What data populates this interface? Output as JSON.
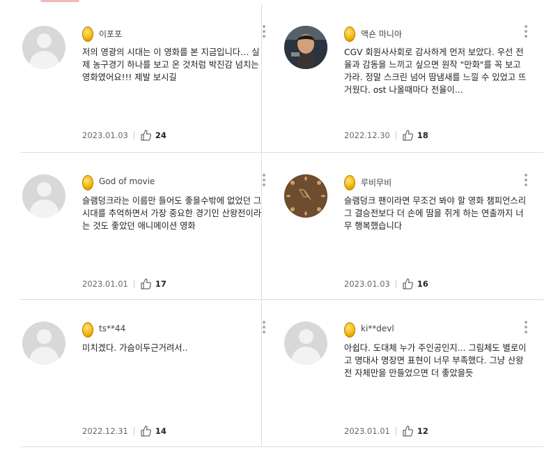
{
  "reviews": [
    {
      "nick": "이포포",
      "text": "저의 영광의 시대는 이 영화를 본 지금입니다… 실제 농구경기 하나를 보고 온 것처럼 박진감 넘치는 영화였어요!!! 제발 보시길",
      "date": "2023.01.03",
      "likes": "24",
      "avatar": "default"
    },
    {
      "nick": "액숀 마니아",
      "text": "CGV 회원사사회로 감사하게 먼저 보았다. 우선 전율과 감동을 느끼고 싶으면 원작 \"만화\"를 꼭 보고 가라. 정말 스크린 넘어 땀냄새를 느낄 수 있었고 뜨거웠다. ost 나올때마다 전율이...",
      "date": "2022.12.30",
      "likes": "18",
      "avatar": "photo"
    },
    {
      "nick": "God of movie",
      "text": "슬램덩크라는 이름만 들어도 좋을수밖에 없었던 그 시대를 추억하면서 가장 중요한 경기인 산왕전이라는 것도 좋았던 애니메이션 영화",
      "date": "2023.01.01",
      "likes": "17",
      "avatar": "default"
    },
    {
      "nick": "루비무비",
      "text": "슬램덩크 팬이라면 무조건 봐야 할 영화 챔피언스리그 결승전보다 더 손에 땀을 쥐게 하는 연출까지 너무 행복했습니다",
      "date": "2023.01.03",
      "likes": "16",
      "avatar": "pattern"
    },
    {
      "nick": "ts**44",
      "text": "미치겠다. 가슴이두근거려서..",
      "date": "2022.12.31",
      "likes": "14",
      "avatar": "default"
    },
    {
      "nick": "ki**devl",
      "text": "아쉽다. 도대체 누가 주인공인지... 그림체도 별로이고 명대사 명장면 표현이 너무 부족했다. 그냥 산왕전 자체만을 만들었으면 더 좋았을듯",
      "date": "2023.01.01",
      "likes": "12",
      "avatar": "default"
    }
  ],
  "icons": {
    "coin": "gold-coin-icon",
    "like": "thumbs-up-icon",
    "more": "more-vertical-icon"
  }
}
